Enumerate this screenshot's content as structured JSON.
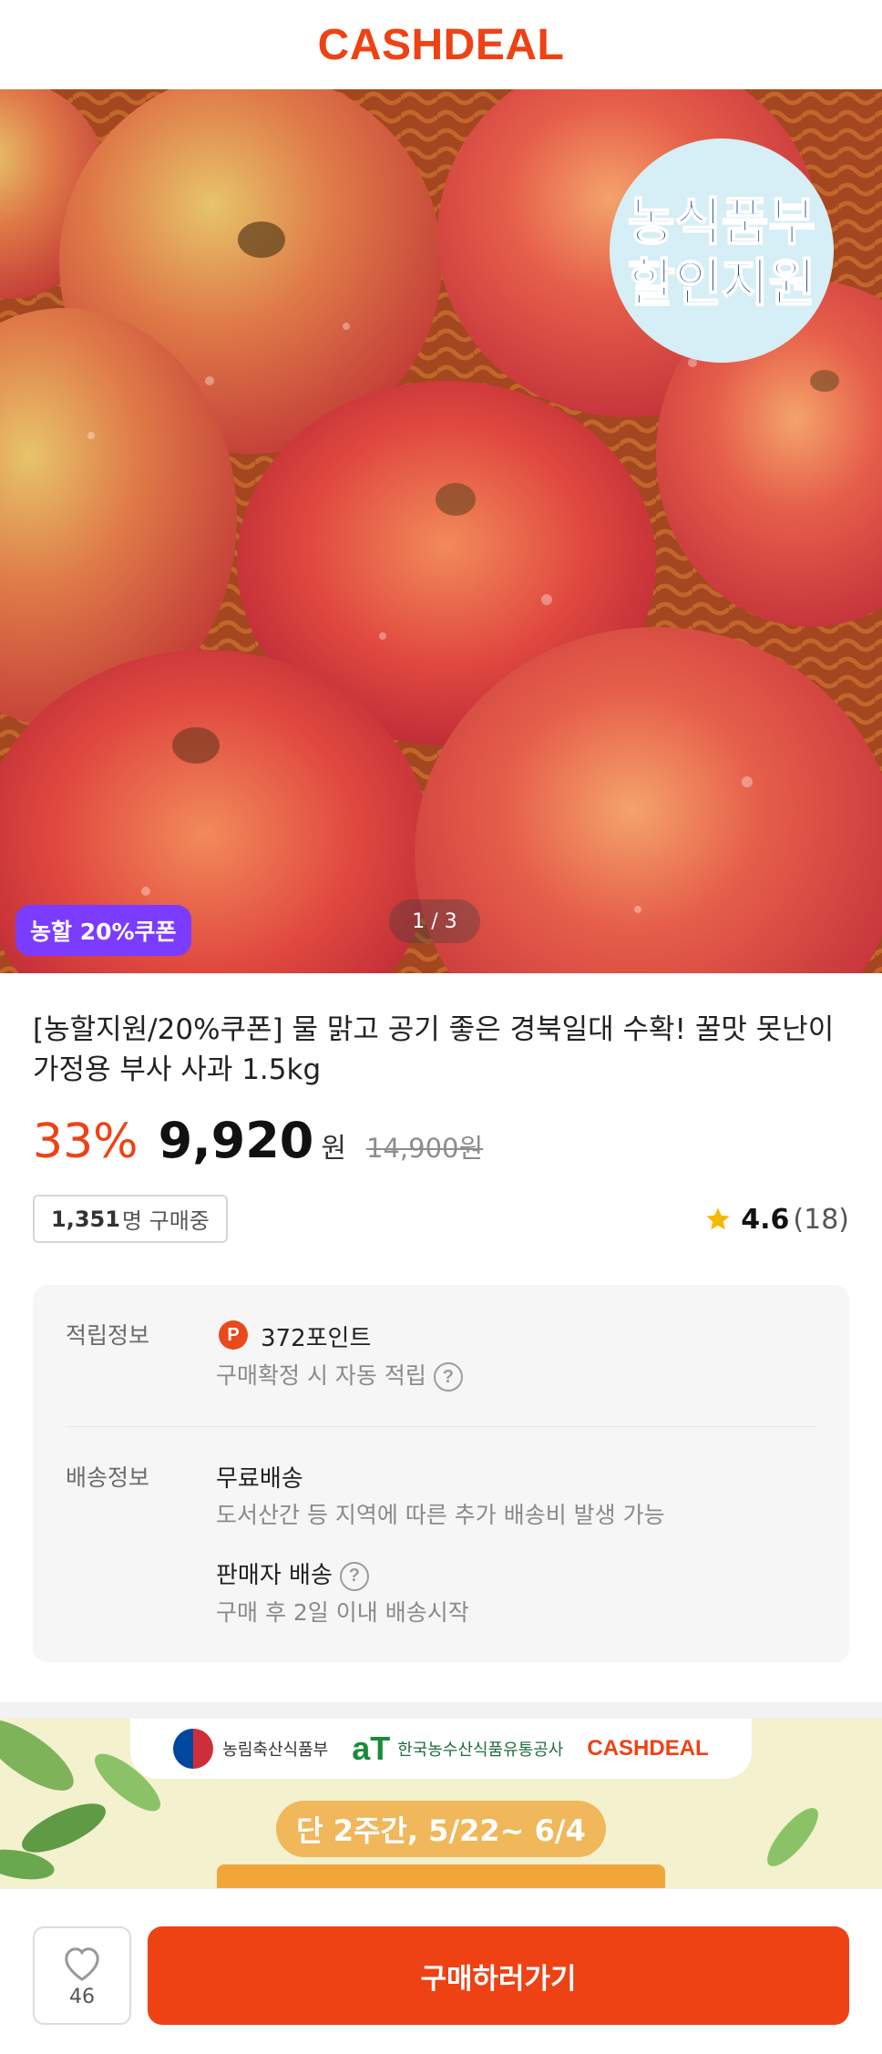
{
  "header": {
    "logo": "CASHDEAL"
  },
  "hero": {
    "seal_line1": "농식품부",
    "seal_line2": "할인지원",
    "coupon_badge": "농할 20%쿠폰",
    "pager": "1 / 3"
  },
  "product": {
    "title": "[농할지원/20%쿠폰] 물 맑고 공기 좋은 경북일대 수확! 꿀맛 못난이 가정용 부사 사과 1.5kg",
    "discount": "33%",
    "price": "9,920",
    "currency": "원",
    "original_price": "14,900원",
    "buying_count": "1,351",
    "buying_suffix": "명 구매중",
    "rating": "4.6",
    "review_count": "(18)"
  },
  "info": {
    "points_label": "적립정보",
    "points_icon": "P",
    "points_value": "372포인트",
    "points_note": "구매확정 시 자동 적립",
    "shipping_label": "배송정보",
    "shipping_free": "무료배송",
    "shipping_note": "도서산간 등 지역에 따른 추가 배송비 발생 가능",
    "seller_shipping": "판매자 배송",
    "seller_note": "구매 후 2일 이내 배송시작",
    "help_glyph": "?"
  },
  "promo": {
    "ministry": "농림축산식품부",
    "at_mark": "aT",
    "at_name": "한국농수산식품유통공사",
    "partner": "CASHDEAL",
    "period": "단 2주간, 5/22~ 6/4"
  },
  "bottom": {
    "like_count": "46",
    "buy_label": "구매하러가기"
  },
  "colors": {
    "brand": "#ee4215",
    "coupon": "#7c3cff",
    "star": "#f5b800"
  },
  "icons": [
    "heart-icon",
    "star-icon",
    "points-icon",
    "question-icon",
    "ministry-emblem-icon"
  ]
}
